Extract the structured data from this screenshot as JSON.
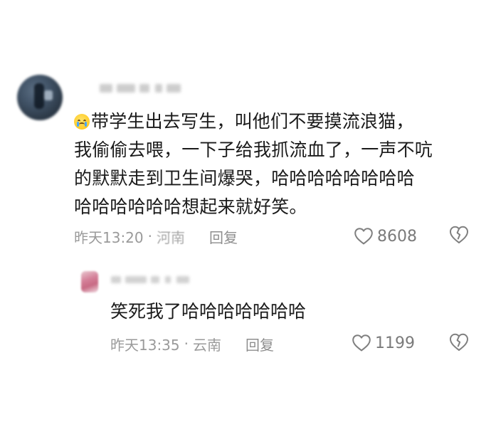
{
  "main_comment": {
    "emoji": "crying-face",
    "text_lines": [
      "带学生出去写生，叫他们不要摸流浪猫，",
      "我偷偷去喂，一下子给我抓流血了，一声不吭",
      "的默默走到卫生间爆哭，哈哈哈哈哈哈哈哈",
      "哈哈哈哈哈哈想起来就好笑。"
    ],
    "time": "昨天13:20",
    "separator": "·",
    "location": "河南",
    "reply_label": "回复",
    "likes": "8608",
    "icons": {
      "like": "heart-outline-icon",
      "dislike": "broken-heart-icon"
    }
  },
  "reply_comment": {
    "text": "笑死我了哈哈哈哈哈哈哈",
    "time": "昨天13:35",
    "separator": "·",
    "location": "云南",
    "reply_label": "回复",
    "likes": "1199",
    "icons": {
      "like": "heart-outline-icon",
      "dislike": "broken-heart-icon"
    }
  }
}
